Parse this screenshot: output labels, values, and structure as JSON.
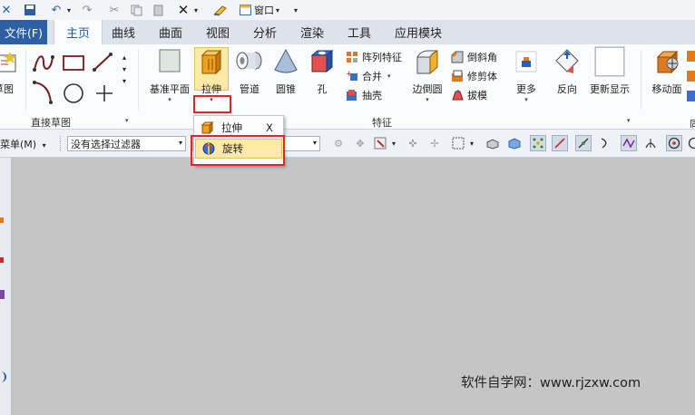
{
  "quick_access": {
    "window_label": "窗口"
  },
  "tabs": [
    {
      "label": "文件(F)"
    },
    {
      "label": "主页"
    },
    {
      "label": "曲线"
    },
    {
      "label": "曲面"
    },
    {
      "label": "视图"
    },
    {
      "label": "分析"
    },
    {
      "label": "渲染"
    },
    {
      "label": "工具"
    },
    {
      "label": "应用模块"
    }
  ],
  "ribbon": {
    "direct_sketch": {
      "sketch_label": "草图",
      "group_label": "直接草图"
    },
    "feature": {
      "datum_plane": "基准平面",
      "extrude": "拉伸",
      "tube": "管道",
      "cone": "圆锥",
      "hole": "孔",
      "pattern_feature": "阵列特征",
      "unite": "合并",
      "shell": "抽壳",
      "edge_blend": "边倒圆",
      "chamfer": "倒斜角",
      "trim_body": "修剪体",
      "draft": "拔模",
      "more": "更多",
      "reverse": "反向",
      "update_display": "更新显示",
      "group_label": "特征"
    },
    "move_face": "移动面"
  },
  "selection_bar": {
    "menu_label": "菜单(M)",
    "filter_value": "没有选择过滤器"
  },
  "dropdown": {
    "items": [
      {
        "label": "拉伸",
        "shortcut": "X"
      },
      {
        "label": "旋转"
      }
    ]
  },
  "watermark": "软件自学网：www.rjzxw.com",
  "colors": {
    "file_tab": "#2c5fa6",
    "active_tab_text": "#1a5db5",
    "highlight": "#e0262b",
    "canvas": "#c5c5c5"
  }
}
